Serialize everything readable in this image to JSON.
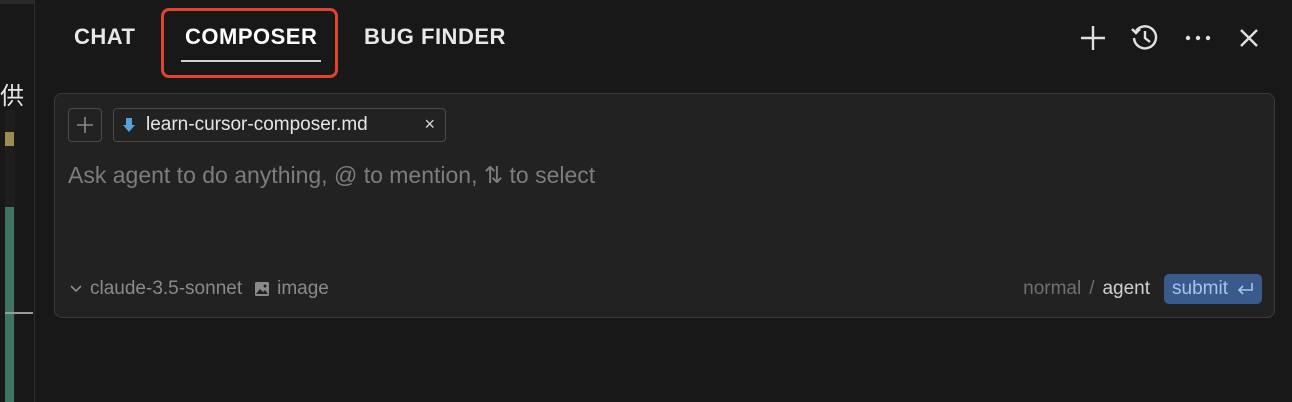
{
  "left_strip": {
    "glyph": "供"
  },
  "tabs": [
    {
      "label": "CHAT"
    },
    {
      "label": "COMPOSER",
      "active": true
    },
    {
      "label": "BUG FINDER"
    }
  ],
  "toolbar": {
    "icons": [
      "plus-icon",
      "history-icon",
      "more-icon",
      "close-icon"
    ]
  },
  "composer": {
    "file_chip": {
      "icon": "markdown-arrow-icon",
      "name": "learn-cursor-composer.md",
      "remove": "×"
    },
    "placeholder": "Ask agent to do anything, @ to mention, ⇅ to select",
    "model": "claude-3.5-sonnet",
    "image_label": "image",
    "mode_normal": "normal",
    "mode_separator": "/",
    "mode_agent": "agent",
    "submit_label": "submit"
  },
  "colors": {
    "background": "#181818",
    "highlight_border": "#e0442f",
    "submit_bg": "#3a5a8c",
    "file_icon": "#5aa0d8"
  }
}
